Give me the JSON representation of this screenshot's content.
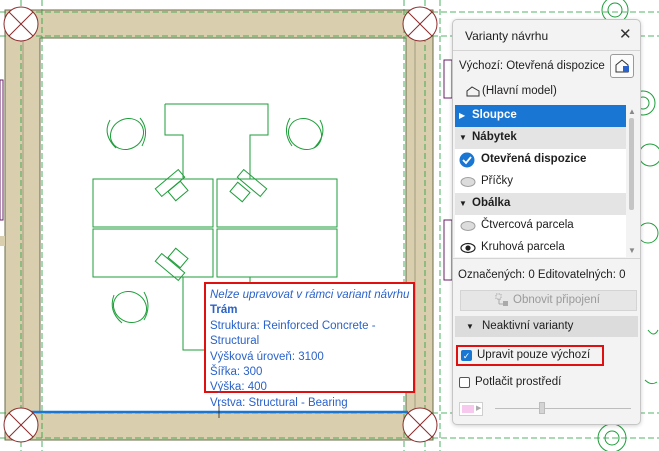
{
  "tooltip": {
    "message": "Nelze upravovat v rámci variant návrhu",
    "element": "Trám",
    "lines": [
      "Struktura: Reinforced Concrete - Structural",
      "Výšková úroveň: 3100",
      "Šířka: 300",
      "Výška: 400",
      "Vrstva: Structural - Bearing"
    ]
  },
  "panel": {
    "title": "Varianty návrhu",
    "default_label": "Výchozí: Otevřená dispozice",
    "main_model": "(Hlavní model)",
    "tree": [
      {
        "label": "Sloupce",
        "kind": "group",
        "selected": true,
        "expanded": false
      },
      {
        "label": "Nábytek",
        "kind": "group",
        "selected": false,
        "expanded": true
      },
      {
        "label": "Otevřená dispozice",
        "kind": "item",
        "state": "active-check",
        "bold": true
      },
      {
        "label": "Příčky",
        "kind": "item",
        "state": "hidden"
      },
      {
        "label": "Obálka",
        "kind": "group",
        "selected": false,
        "expanded": true
      },
      {
        "label": "Čtvercová parcela",
        "kind": "item",
        "state": "hidden"
      },
      {
        "label": "Kruhová parcela",
        "kind": "item",
        "state": "visible"
      }
    ],
    "counts": "Označených: 0 Editovatelných: 0",
    "refresh_button": "Obnovit připojení",
    "inactive_label": "Neaktivní varianty",
    "edit_default_only": {
      "label": "Upravit pouze výchozí",
      "checked": true
    },
    "suppress_env": {
      "label": "Potlačit prostředí",
      "checked": false
    }
  },
  "colors": {
    "accent": "#1976d2",
    "drawing_green": "#1e9e3a",
    "annotation_red": "#e01010",
    "tooltip_text": "#2a62c9",
    "wall_tan": "#d9cfaf"
  }
}
